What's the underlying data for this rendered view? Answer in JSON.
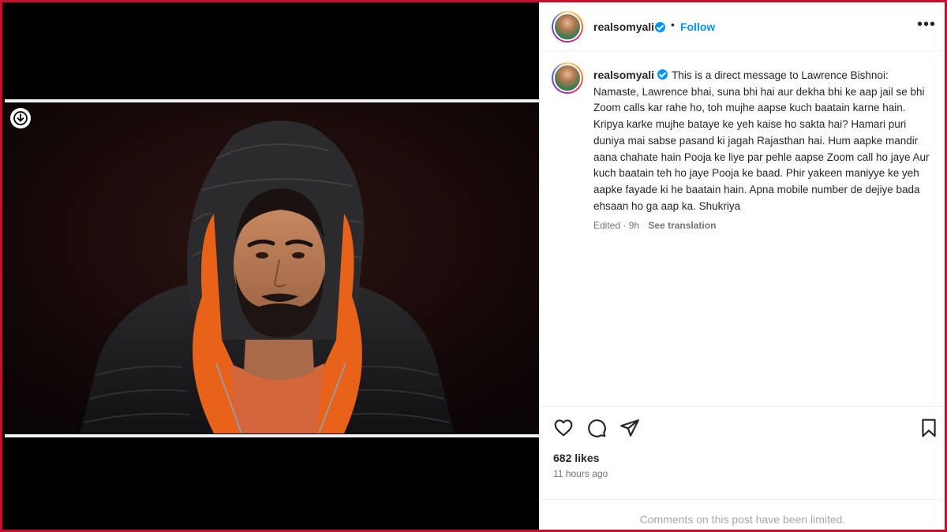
{
  "post": {
    "username": "realsomyali",
    "follow_label": "Follow",
    "separator": "•",
    "more_label": "•••",
    "caption": "This is a direct message to Lawrence Bishnoi: Namaste, Lawrence bhai, suna bhi hai aur dekha bhi ke aap jail se bhi Zoom calls kar rahe ho, toh mujhe aapse kuch baatain karne hain. Kripya karke mujhe bataye ke yeh kaise ho sakta hai? Hamari puri duniya mai sabse pasand ki jagah Rajasthan hai. Hum aapke mandir aana chahate hain Pooja ke liye par pehle aapse Zoom call ho jaye Aur kuch baatain teh ho jaye Pooja ke baad. Phir yakeen maniyye ke yeh aapke fayade ki he baatain hain. Apna mobile number de dejiye bada ehsaan ho ga aap ka. Shukriya",
    "edited_time": "Edited · 9h",
    "see_translation": "See translation",
    "likes": "682 likes",
    "time_ago": "11 hours ago",
    "comments_limited": "Comments on this post have been limited."
  },
  "icons": {
    "verified": "verified-badge-icon",
    "like": "heart-icon",
    "comment": "comment-bubble-icon",
    "share": "paper-plane-icon",
    "save": "bookmark-icon",
    "download": "download-arrow-icon"
  },
  "colors": {
    "accent": "#0095f6",
    "frame_border": "#c8102e",
    "secondary_text": "#737373",
    "hood_orange": "#e8621a"
  }
}
